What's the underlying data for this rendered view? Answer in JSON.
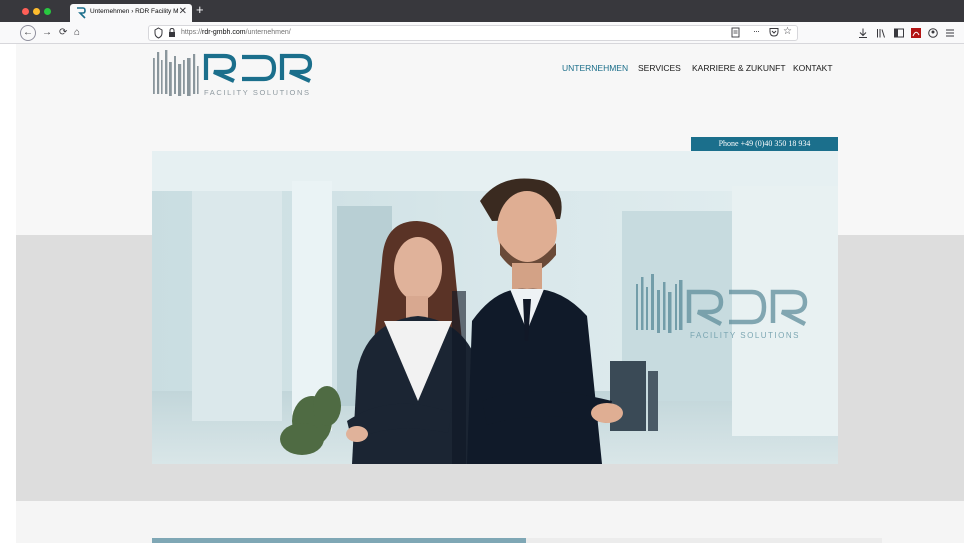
{
  "browser": {
    "tab_title": "Unternehmen › RDR Facility Ma",
    "tab_close": "✕",
    "new_tab": "+",
    "url_prefix": "https://",
    "url_host": "rdr-gmbh.com",
    "url_path": "/unternehmen/",
    "more_label": "···",
    "nav_icons": {
      "back": "←",
      "forward": "→",
      "reload": "⟳",
      "home": "⌂"
    },
    "toolbar_icons": [
      "download-icon",
      "library-icon",
      "sidebar-icon",
      "pdf-icon",
      "account-icon",
      "menu-icon"
    ]
  },
  "site": {
    "logo_text": "FACILITY SOLUTIONS",
    "nav": [
      "UNTERNEHMEN",
      "SERVICES",
      "KARRIERE & ZUKUNFT",
      "KONTAKT"
    ],
    "phone": "Phone +49 (0)40 350 18 934",
    "hero_watermark_text": "FACILITY SOLUTIONS"
  },
  "colors": {
    "brand": "#1b6f8c",
    "nav_active": "#1b6e8a",
    "tabbar": "#38383d"
  }
}
